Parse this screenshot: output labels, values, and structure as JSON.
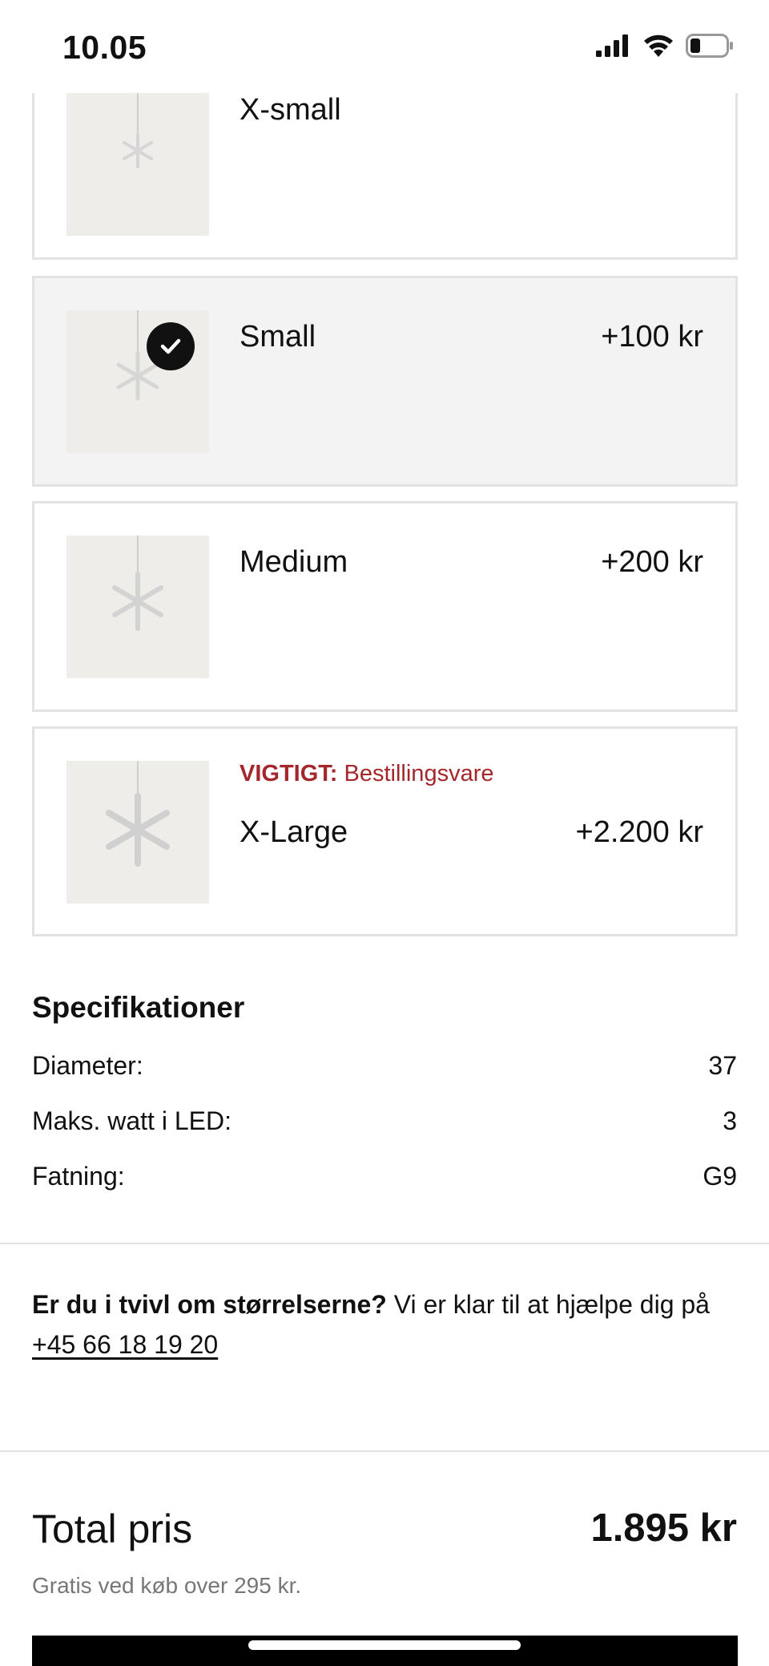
{
  "status_bar": {
    "time": "10.05",
    "icons": [
      "cellular-signal-icon",
      "wifi-icon",
      "battery-icon"
    ]
  },
  "options": [
    {
      "name": "X-small",
      "price": "",
      "selected": false,
      "icon": "snowflake-lamp-image"
    },
    {
      "name": "Small",
      "price": "+100 kr",
      "selected": true,
      "icon": "snowflake-lamp-image"
    },
    {
      "name": "Medium",
      "price": "+200 kr",
      "selected": false,
      "icon": "snowflake-lamp-image"
    },
    {
      "name": "X-Large",
      "price": "+2.200 kr",
      "selected": false,
      "icon": "snowflake-lamp-image",
      "notice_label": "VIGTIGT:",
      "notice_text": " Bestillingsvare"
    }
  ],
  "specs": {
    "title": "Specifikationer",
    "rows": [
      {
        "label": "Diameter:",
        "value": "37"
      },
      {
        "label": "Maks. watt i LED:",
        "value": "3"
      },
      {
        "label": "Fatning:",
        "value": "G9"
      }
    ]
  },
  "help": {
    "question": "Er du i tvivl om størrelserne?",
    "text": " Vi er klar til at hjælpe dig på ",
    "phone": "+45 66 18 19 20"
  },
  "total": {
    "label": "Total pris",
    "value": "1.895 kr",
    "shipping_note": "Gratis ved køb over 295 kr."
  },
  "colors": {
    "notice": "#a4282b",
    "selected_bg": "#f3f3f3",
    "border": "#e3e3e3"
  }
}
